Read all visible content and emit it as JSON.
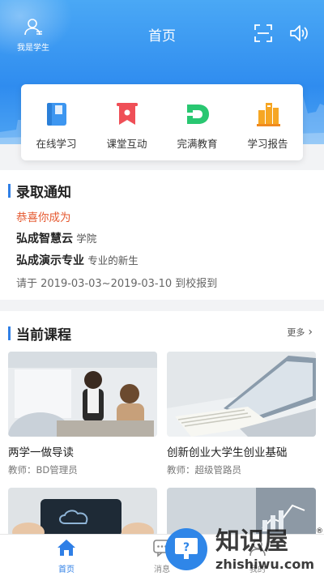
{
  "header": {
    "user_label": "我是学生",
    "title": "首页"
  },
  "quick_actions": [
    {
      "label": "在线学习",
      "icon": "book-icon",
      "color": "#3d96f0"
    },
    {
      "label": "课堂互动",
      "icon": "banner-icon",
      "color": "#ef4f57"
    },
    {
      "label": "完满教育",
      "icon": "d-letter-icon",
      "color": "#29c771"
    },
    {
      "label": "学习报告",
      "icon": "bar-chart-icon",
      "color": "#f6a623"
    }
  ],
  "admission": {
    "title": "录取通知",
    "congrats": "恭喜你成为",
    "school_name": "弘成智慧云",
    "school_suffix": "学院",
    "major_name": "弘成演示专业",
    "major_suffix": "专业的新生",
    "report_text": "请于 2019-03-03~2019-03-10 到校报到"
  },
  "courses": {
    "title": "当前课程",
    "more_label": "更多",
    "items": [
      {
        "title": "两学一做导读",
        "teacher": "教师：BD管理员"
      },
      {
        "title": "创新创业大学生创业基础",
        "teacher": "教师：超级管路员"
      }
    ]
  },
  "tabs": [
    {
      "label": "首页",
      "active": true
    },
    {
      "label": "消息",
      "active": false
    },
    {
      "label": "我的",
      "active": false
    }
  ],
  "watermark": {
    "brand": "知识屋",
    "domain": "zhishiwu.com"
  },
  "colors": {
    "primary": "#2f8cef",
    "accent_orange": "#e5582f",
    "section_bar": "#2f7fe6"
  }
}
